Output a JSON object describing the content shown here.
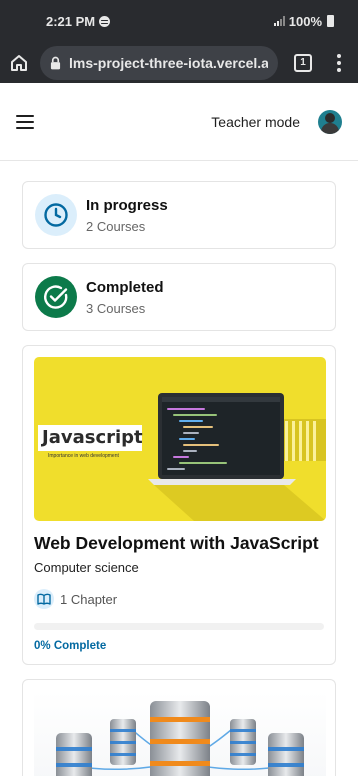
{
  "status_bar": {
    "time": "2:21 PM",
    "battery": "100%"
  },
  "browser": {
    "url": "lms-project-three-iota.vercel.app",
    "tab_count": "1"
  },
  "header": {
    "teacher_mode": "Teacher mode"
  },
  "stats": [
    {
      "title": "In progress",
      "subtitle": "2 Courses",
      "icon": "clock-icon",
      "color": "#0369a1"
    },
    {
      "title": "Completed",
      "subtitle": "3 Courses",
      "icon": "check-circle-icon",
      "color": "#0c7a4a"
    }
  ],
  "courses": [
    {
      "thumbnail": {
        "heading": "Javascript",
        "tagline": "Importance in web development"
      },
      "title": "Web Development with JavaScript",
      "category": "Computer science",
      "chapters": "1 Chapter",
      "progress": 0,
      "progress_label": "0% Complete"
    }
  ],
  "colors": {
    "accent": "#0369a1",
    "success": "#0c7a4a",
    "thumbnail_yellow": "#f0de2c"
  }
}
